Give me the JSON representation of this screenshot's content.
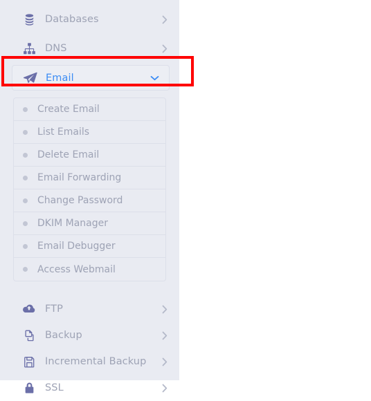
{
  "sidebar": {
    "top_items": [
      {
        "label": "Databases",
        "icon": "database-icon",
        "chevron": "chevron-right-icon",
        "expanded": false
      },
      {
        "label": "DNS",
        "icon": "sitemap-icon",
        "chevron": "chevron-right-icon",
        "expanded": false
      }
    ],
    "active_item": {
      "label": "Email",
      "icon": "paper-plane-icon",
      "chevron": "chevron-down-icon",
      "expanded": true
    },
    "submenu": [
      {
        "label": "Create Email",
        "bullet": "bullet-dot-icon"
      },
      {
        "label": "List Emails",
        "bullet": "bullet-dot-icon"
      },
      {
        "label": "Delete Email",
        "bullet": "bullet-dot-icon"
      },
      {
        "label": "Email Forwarding",
        "bullet": "bullet-dot-icon"
      },
      {
        "label": "Change Password",
        "bullet": "bullet-dot-icon"
      },
      {
        "label": "DKIM Manager",
        "bullet": "bullet-dot-icon"
      },
      {
        "label": "Email Debugger",
        "bullet": "bullet-dot-icon"
      },
      {
        "label": "Access Webmail",
        "bullet": "bullet-dot-icon"
      }
    ],
    "lower_items": [
      {
        "label": "FTP",
        "icon": "cloud-upload-icon",
        "chevron": "chevron-right-icon"
      },
      {
        "label": "Backup",
        "icon": "copy-pages-icon",
        "chevron": "chevron-right-icon"
      },
      {
        "label": "Incremental Backup",
        "icon": "floppy-save-icon",
        "chevron": "chevron-right-icon"
      },
      {
        "label": "SSL",
        "icon": "padlock-icon",
        "chevron": "chevron-right-icon"
      }
    ]
  },
  "annotation": {
    "name": "highlight-rectangle",
    "target": "Email",
    "color": "#ff0000"
  },
  "colors": {
    "sidebar_bg": "#e9ebf2",
    "page_bg": "#ffffff",
    "label": "#9ea3b5",
    "icon": "#6b6fa8",
    "active_label": "#3c8cf4",
    "border": "#dcdfe9",
    "bullet": "#c2c6d4",
    "highlight": "#ff0000"
  }
}
